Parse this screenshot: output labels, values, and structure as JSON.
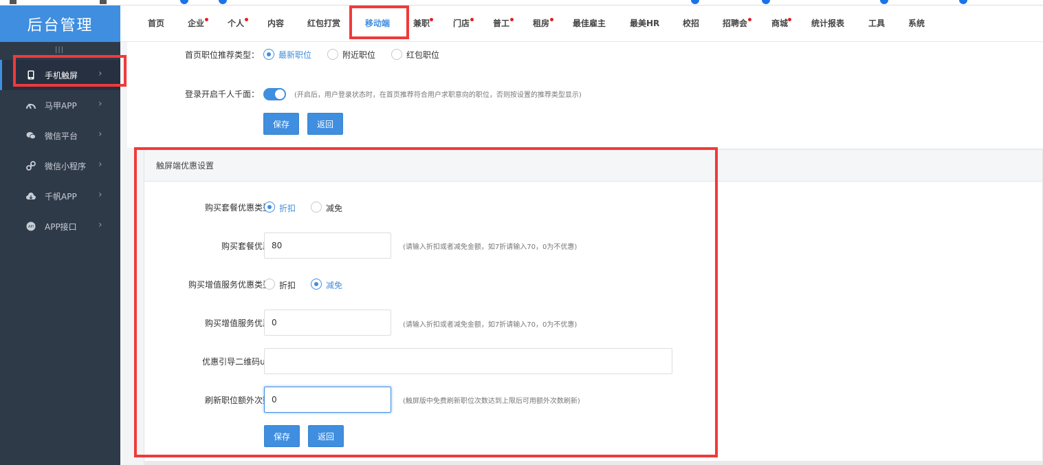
{
  "app": {
    "logo_text": "后台管理",
    "accent_color": "#3f8ee0",
    "highlight_color": "#f03a3a"
  },
  "topnav": {
    "items": [
      {
        "label": "首页",
        "dot": false
      },
      {
        "label": "企业",
        "dot": true
      },
      {
        "label": "个人",
        "dot": true
      },
      {
        "label": "内容",
        "dot": false
      },
      {
        "label": "红包打赏",
        "dot": false
      },
      {
        "label": "移动端",
        "dot": false,
        "active": true
      },
      {
        "label": "兼职",
        "dot": true
      },
      {
        "label": "门店",
        "dot": true
      },
      {
        "label": "普工",
        "dot": true
      },
      {
        "label": "租房",
        "dot": true
      },
      {
        "label": "最佳雇主",
        "dot": false
      },
      {
        "label": "最美HR",
        "dot": false
      },
      {
        "label": "校招",
        "dot": false
      },
      {
        "label": "招聘会",
        "dot": true
      },
      {
        "label": "商城",
        "dot": true
      },
      {
        "label": "统计报表",
        "dot": false
      },
      {
        "label": "工具",
        "dot": false
      },
      {
        "label": "系统",
        "dot": false
      }
    ]
  },
  "sidebar": {
    "collapse_handle": "|||",
    "items": [
      {
        "label": "手机触屏",
        "icon": "phone-icon",
        "active": true
      },
      {
        "label": "马甲APP",
        "icon": "speedometer-icon"
      },
      {
        "label": "微信平台",
        "icon": "wechat-icon"
      },
      {
        "label": "微信小程序",
        "icon": "mini-program-icon"
      },
      {
        "label": "千帆APP",
        "icon": "cloud-icon"
      },
      {
        "label": "APP接口",
        "icon": "api-icon"
      }
    ]
  },
  "top_form": {
    "recommend_type_label": "首页职位推荐类型：",
    "recommend_options": [
      "最新职位",
      "附近职位",
      "红包职位"
    ],
    "recommend_selected": 0,
    "personalize_label": "登录开启千人千面：",
    "personalize_on": true,
    "personalize_hint": "(开启后，用户登录状态时，在首页推荐符合用户求职意向的职位，否则按设置的推荐类型显示)",
    "save_label": "保存",
    "back_label": "返回"
  },
  "discount_section": {
    "title": "触屏端优惠设置",
    "package_type_label": "购买套餐优惠类型:",
    "package_type_options": [
      "折扣",
      "减免"
    ],
    "package_type_selected": 0,
    "package_discount_label": "购买套餐优惠:",
    "package_discount_value": "80",
    "package_discount_hint": "(请输入折扣或者减免金额，如7折请输入70，0为不优惠)",
    "service_type_label": "购买增值服务优惠类型:",
    "service_type_options": [
      "折扣",
      "减免"
    ],
    "service_type_selected": 1,
    "service_discount_label": "购买增值服务优惠:",
    "service_discount_value": "0",
    "service_discount_hint": "(请输入折扣或者减免金额，如7折请输入70，0为不优惠)",
    "qrcode_label": "优惠引导二维码url:",
    "qrcode_value": "",
    "refresh_label": "刷新职位额外次数:",
    "refresh_value": "0",
    "refresh_hint": "(触屏版中免费刷新职位次数达到上限后可用额外次数刷新)",
    "save_label": "保存",
    "back_label": "返回"
  }
}
